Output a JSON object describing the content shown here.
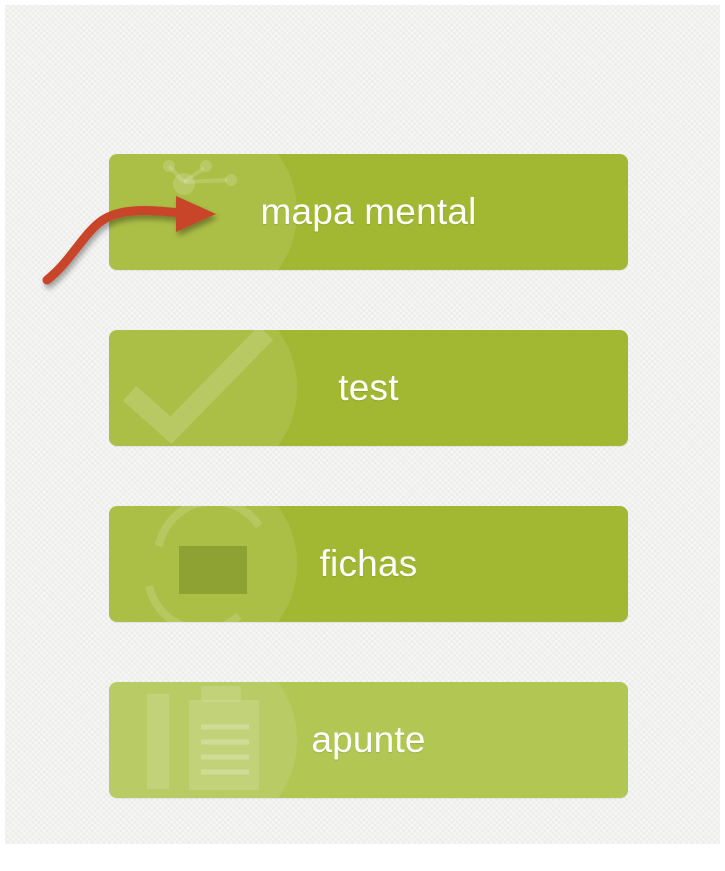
{
  "menu": {
    "items": [
      {
        "label": "mapa mental",
        "icon": "mind-map-icon"
      },
      {
        "label": "test",
        "icon": "checkmark-icon"
      },
      {
        "label": "fichas",
        "icon": "flashcards-icon"
      },
      {
        "label": "apunte",
        "icon": "notes-icon"
      }
    ]
  },
  "annotation": {
    "icon": "red-arrow-icon"
  },
  "colors": {
    "button_green": "#a2b832",
    "button_green_light": "#b2c653",
    "background": "#f1f1f0",
    "arrow_red": "#c8442c",
    "label_text": "#ffffff"
  }
}
